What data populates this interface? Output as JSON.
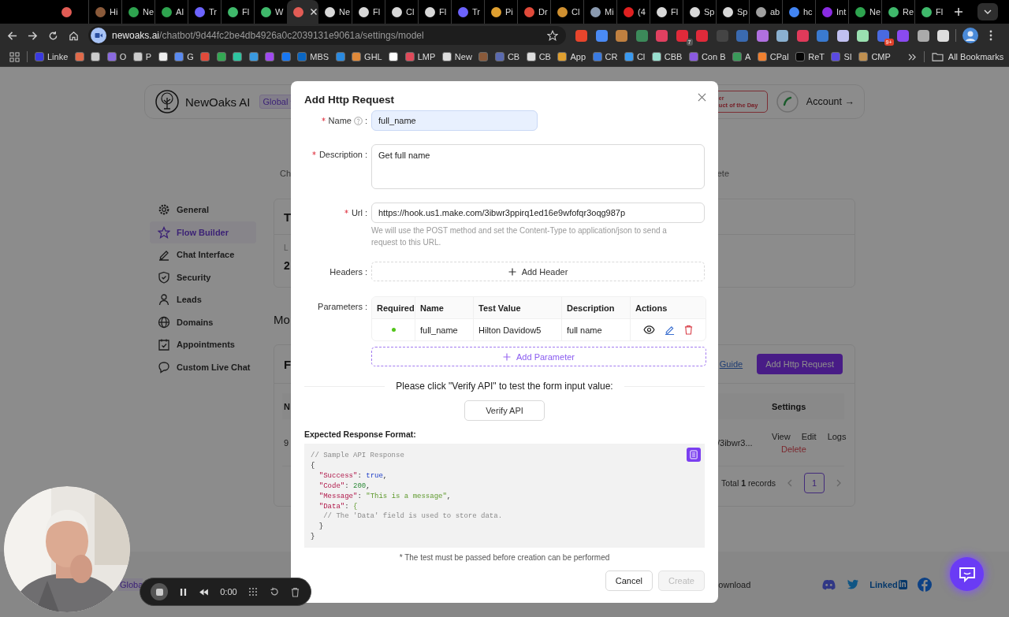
{
  "browser": {
    "tabs": [
      {
        "color": "#e25c55",
        "selected": false
      },
      {
        "title": "Hi",
        "color": "#8a5a3a",
        "selected": false
      },
      {
        "title": "Ne",
        "color": "#2ea44f",
        "selected": false
      },
      {
        "title": "AI",
        "color": "#2ea44f",
        "selected": false
      },
      {
        "title": "Tr",
        "color": "#6c63ff",
        "selected": false
      },
      {
        "title": "Fl",
        "color": "#3fb96b",
        "selected": false
      },
      {
        "title": "W",
        "color": "#3fb96b",
        "selected": false
      },
      {
        "color": "#e25c55",
        "selected": true
      },
      {
        "title": "Ne",
        "color": "#d8d8d8",
        "selected": false
      },
      {
        "title": "Fl",
        "color": "#d8d8d8",
        "selected": false
      },
      {
        "title": "Cl",
        "color": "#d8d8d8",
        "selected": false
      },
      {
        "title": "Fl",
        "color": "#d8d8d8",
        "selected": false
      },
      {
        "title": "Tr",
        "color": "#6c63ff",
        "selected": false
      },
      {
        "title": "Pi",
        "color": "#e0a030",
        "selected": false
      },
      {
        "title": "Dr",
        "color": "#e04a3a",
        "selected": false
      },
      {
        "title": "Cl",
        "color": "#d09030",
        "selected": false
      },
      {
        "title": "Mi",
        "color": "#8a9ab0",
        "selected": false
      },
      {
        "title": "(4",
        "color": "#e02020",
        "selected": false
      },
      {
        "title": "Fl",
        "color": "#d8d8d8",
        "selected": false
      },
      {
        "title": "Sp",
        "color": "#d8d8d8",
        "selected": false
      },
      {
        "title": "Sp",
        "color": "#d8d8d8",
        "selected": false
      },
      {
        "title": "ab",
        "color": "#a0a0a0",
        "selected": false
      },
      {
        "title": "hc",
        "color": "#4285f4",
        "selected": false
      },
      {
        "title": "Int",
        "color": "#8a2be2",
        "selected": false
      },
      {
        "title": "Ne",
        "color": "#2ea44f",
        "selected": false
      },
      {
        "title": "Re",
        "color": "#3fb96b",
        "selected": false
      },
      {
        "title": "Fl",
        "color": "#3fb96b",
        "selected": false
      }
    ],
    "address": {
      "host": "newoaks.ai",
      "path": "/chatbot/9d44fc2be4db4926a0c2039131e9061a/settings/model"
    },
    "extensions": [
      {
        "color": "#e8452c"
      },
      {
        "color": "#4a8af4"
      },
      {
        "color": "#c08040"
      },
      {
        "color": "#3c8a5a"
      },
      {
        "color": "#e04060"
      },
      {
        "color": "#e02a3a",
        "badge": "7"
      },
      {
        "color": "#e02a3a"
      },
      {
        "color": "#444444"
      },
      {
        "color": "#3a6ab0"
      },
      {
        "color": "#b070e0"
      },
      {
        "color": "#8ab0d0"
      },
      {
        "color": "#e03a5a"
      },
      {
        "color": "#3a7ad0"
      },
      {
        "color": "#c0c0f0"
      },
      {
        "color": "#9ae0b0"
      },
      {
        "color": "#4a6ae0",
        "badge": "9+"
      },
      {
        "color": "#8a4af0"
      },
      {
        "color": "#aaaaaa"
      },
      {
        "color": "#dddddd"
      }
    ],
    "bookmarks": [
      {
        "label": "Linke",
        "color": "#3a3ae0"
      },
      {
        "color": "#e06a4a"
      },
      {
        "color": "#cccccc"
      },
      {
        "label": "O",
        "color": "#8a6ae0"
      },
      {
        "label": "P",
        "color": "#cccccc"
      },
      {
        "color": "#eeeeee"
      },
      {
        "label": "G",
        "color": "#5a8af0"
      },
      {
        "color": "#e04a3a"
      },
      {
        "color": "#34a853"
      },
      {
        "color": "#2ec4a0"
      },
      {
        "color": "#3a9ae0"
      },
      {
        "color": "#a04af0"
      },
      {
        "color": "#1877f2"
      },
      {
        "label": "MBS",
        "color": "#0a66c2"
      },
      {
        "color": "#2a8ae0"
      },
      {
        "label": "GHL",
        "color": "#e08a3a"
      },
      {
        "color": "#ffffff"
      },
      {
        "label": "LMP",
        "color": "#e04a5a"
      },
      {
        "label": "New",
        "color": "#dddddd"
      },
      {
        "color": "#8a5a3a"
      },
      {
        "label": "CB",
        "color": "#5a6ab0"
      },
      {
        "label": "CB",
        "color": "#dddddd"
      },
      {
        "label": "App",
        "color": "#e0a030"
      },
      {
        "label": "CR",
        "color": "#3a7ae0"
      },
      {
        "label": "Cl",
        "color": "#3a9af0"
      },
      {
        "label": "CBB",
        "color": "#9ae0d0"
      },
      {
        "label": "Con B",
        "color": "#8a5ae0"
      },
      {
        "label": "A",
        "color": "#3a9a5a"
      },
      {
        "label": "CPal",
        "color": "#f08030"
      },
      {
        "label": "ReT",
        "color": "#050505"
      },
      {
        "label": "SI",
        "color": "#5a4ae0"
      },
      {
        "label": "CMP",
        "color": "#c09050"
      }
    ],
    "all_bookmarks": "All Bookmarks"
  },
  "app": {
    "brand": "NewOaks AI",
    "scope": "Global",
    "promo": [
      "er",
      "uct of the Day"
    ],
    "account": "Account →",
    "sidebar": [
      {
        "label": "General",
        "selected": false
      },
      {
        "label": "Flow Builder",
        "selected": true
      },
      {
        "label": "Chat Interface",
        "selected": false
      },
      {
        "label": "Security",
        "selected": false
      },
      {
        "label": "Leads",
        "selected": false
      },
      {
        "label": "Domains",
        "selected": false
      },
      {
        "label": "Appointments",
        "selected": false
      },
      {
        "label": "Custom Live Chat",
        "selected": false
      }
    ],
    "tabs_row": [
      "Ch",
      "ete"
    ],
    "card_1": {
      "title": "T",
      "label": "L",
      "value": "2"
    },
    "section_title": "Mo",
    "card_2": {
      "title": "F",
      "guide": "Guide",
      "add_button": "Add Http Request",
      "columns": [
        "N",
        "Settings"
      ],
      "row": {
        "column_1": "9",
        "column_2": "/3ibwr3...",
        "actions": [
          "View",
          "Edit",
          "Logs"
        ],
        "delete": "Delete"
      },
      "total": "Total **1** records",
      "pages": [
        {
          "label": "1",
          "selected": true
        }
      ]
    },
    "footer": {
      "left": "Globa",
      "middle": "ownload",
      "linkedin": [
        "Linked",
        "in"
      ]
    }
  },
  "modal": {
    "title": "Add Http Request",
    "fields": [
      {
        "kind": "input",
        "label": "Name",
        "colon": ":",
        "required": true,
        "help": true,
        "autofilled": true,
        "value": "full_name"
      },
      {
        "kind": "textarea",
        "label": "Description",
        "colon": ":",
        "required": true,
        "value": "Get full name"
      },
      {
        "kind": "input",
        "label": "Url",
        "colon": ":",
        "required": true,
        "value": "https://hook.us1.make.com/3ibwr3ppirq1ed16e9wfofqr3oqg987p",
        "hint": "We will use the POST method and set the Content-Type to application/json to send a request to this URL."
      }
    ],
    "headers": {
      "label": "Headers",
      "colon": ":",
      "add": "Add Header"
    },
    "parameters": {
      "label": "Parameters",
      "colon": ":",
      "columns": [
        "Required",
        "Name",
        "Test Value",
        "Description",
        "Actions"
      ],
      "rows": [
        {
          "required": true,
          "name": "full_name",
          "test_value": "Hilton Davidow5",
          "description": "full name"
        }
      ],
      "add": "Add Parameter"
    },
    "verify_prompt": "Please click \"Verify API\" to test the form input value:",
    "verify_button": "Verify API",
    "response_label": "Expected Response Format:",
    "code": [
      [
        {
          "kind": "comment",
          "text": "// Sample API Response"
        }
      ],
      [
        {
          "kind": "punct",
          "text": "{"
        }
      ],
      [
        {
          "kind": "key",
          "text": "  \"Success\""
        },
        {
          "kind": "punct",
          "text": ": "
        },
        {
          "kind": "bool",
          "text": "true"
        },
        {
          "kind": "punct",
          "text": ","
        }
      ],
      [
        {
          "kind": "key",
          "text": "  \"Code\""
        },
        {
          "kind": "punct",
          "text": ": "
        },
        {
          "kind": "number",
          "text": "200"
        },
        {
          "kind": "punct",
          "text": ","
        }
      ],
      [
        {
          "kind": "key",
          "text": "  \"Message\""
        },
        {
          "kind": "punct",
          "text": ": "
        },
        {
          "kind": "string",
          "text": "\"This is a message\""
        },
        {
          "kind": "punct",
          "text": ","
        }
      ],
      [
        {
          "kind": "key",
          "text": "  \"Data\""
        },
        {
          "kind": "punct",
          "text": ": "
        },
        {
          "kind": "string",
          "text": "{"
        }
      ],
      [
        {
          "kind": "comment",
          "text": "   // The 'Data' field is used to store data."
        }
      ],
      [
        {
          "kind": "punct",
          "text": "  }"
        }
      ],
      [
        {
          "kind": "punct",
          "text": "}"
        }
      ]
    ],
    "note": "* The test must be passed before creation can be performed",
    "buttons": [
      {
        "label": "Cancel",
        "kind": "default",
        "disabled": false
      },
      {
        "label": "Create",
        "kind": "primary",
        "disabled": true
      }
    ]
  },
  "recorder": {
    "time": "0:00"
  }
}
